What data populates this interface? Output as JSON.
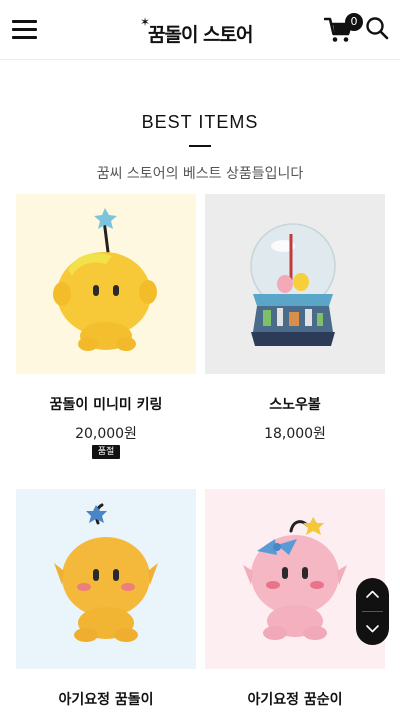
{
  "header": {
    "menu_icon": "hamburger-menu-icon",
    "logo_text": "꿈돌이 스토어",
    "cart_icon": "shopping-cart-icon",
    "cart_count": "0",
    "search_icon": "search-icon"
  },
  "section": {
    "title": "BEST ITEMS",
    "subtitle": "꿈씨 스토어의 베스트 상품들입니다"
  },
  "products": [
    {
      "name": "꿈돌이 미니미 키링",
      "price": "20,000원",
      "badge": "품절",
      "bg": "#fdf8df"
    },
    {
      "name": "스노우볼",
      "price": "18,000원",
      "bg": "#ececec"
    },
    {
      "name": "아기요정 꿈돌이",
      "bg": "#eaf4fb"
    },
    {
      "name": "아기요정 꿈순이",
      "bg": "#fdeef1"
    }
  ],
  "scroll": {
    "up_icon": "chevron-up-icon",
    "down_icon": "chevron-down-icon"
  }
}
